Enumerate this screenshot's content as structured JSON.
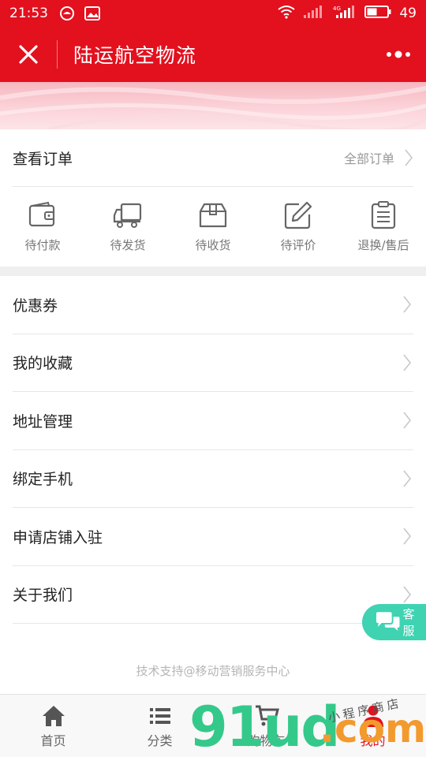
{
  "status_bar": {
    "time": "21:53",
    "battery": "49",
    "network": "4G"
  },
  "nav": {
    "title": "陆运航空物流"
  },
  "orders": {
    "header_label": "查看订单",
    "all_label": "全部订单",
    "items": [
      {
        "label": "待付款",
        "icon": "wallet-icon"
      },
      {
        "label": "待发货",
        "icon": "truck-icon"
      },
      {
        "label": "待收货",
        "icon": "box-icon"
      },
      {
        "label": "待评价",
        "icon": "edit-icon"
      },
      {
        "label": "退换/售后",
        "icon": "clipboard-icon"
      }
    ]
  },
  "menu": {
    "items": [
      {
        "label": "优惠券"
      },
      {
        "label": "我的收藏"
      },
      {
        "label": "地址管理"
      },
      {
        "label": "绑定手机"
      },
      {
        "label": "申请店铺入驻"
      },
      {
        "label": "关于我们"
      }
    ]
  },
  "support_text": "技术支持@移动营销服务中心",
  "service_button": {
    "label": "客服"
  },
  "tabbar": {
    "items": [
      {
        "label": "首页",
        "icon": "home-icon"
      },
      {
        "label": "分类",
        "icon": "list-icon"
      },
      {
        "label": "购物车",
        "icon": "cart-icon"
      },
      {
        "label": "我的",
        "icon": "user-icon"
      }
    ],
    "active_index": 3
  },
  "watermark": {
    "digits": "91ud",
    "domain": ".com",
    "small_text": "小程序商店"
  },
  "colors": {
    "brand_red": "#e3101e",
    "service_green": "#3fd3b2",
    "watermark_green": "#34c98a",
    "watermark_orange": "#f29a2e"
  }
}
